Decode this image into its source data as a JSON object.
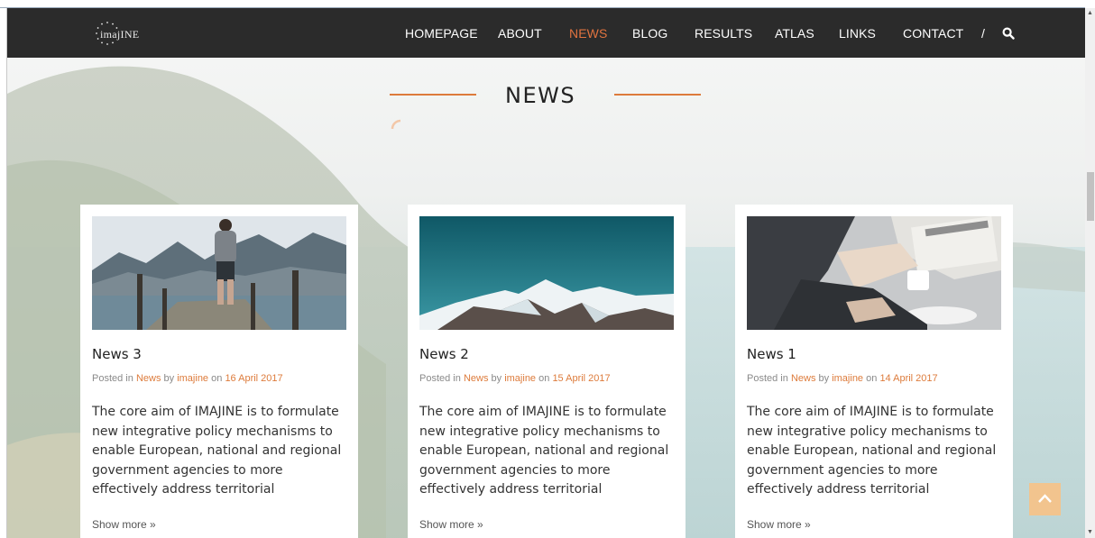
{
  "brand": {
    "logo_text": "imajINE"
  },
  "nav": {
    "items": [
      {
        "label": "HOMEPAGE",
        "active": false
      },
      {
        "label": "ABOUT",
        "active": false
      },
      {
        "label": "NEWS",
        "active": true
      },
      {
        "label": "BLOG",
        "active": false
      },
      {
        "label": "RESULTS",
        "active": false
      },
      {
        "label": "ATLAS",
        "active": false
      },
      {
        "label": "LINKS",
        "active": false
      },
      {
        "label": "CONTACT",
        "active": false
      }
    ],
    "separator": "/",
    "search_icon": "search-icon"
  },
  "page": {
    "heading": "NEWS"
  },
  "posts": [
    {
      "title": "News 3",
      "meta": {
        "posted_in": "Posted in",
        "category": "News",
        "by": "by",
        "author": "imajine",
        "on": "on",
        "date": "16 April 2017"
      },
      "excerpt": "The core aim of IMAJINE is to formulate new integrative policy mechanisms to enable European, national and regional government agencies to more effectively address territorial",
      "more": "Show more »",
      "image": "man-on-pier-mountains"
    },
    {
      "title": "News 2",
      "meta": {
        "posted_in": "Posted in",
        "category": "News",
        "by": "by",
        "author": "imajine",
        "on": "on",
        "date": "15 April 2017"
      },
      "excerpt": "The core aim of IMAJINE is to formulate new integrative policy mechanisms to enable European, national and regional government agencies to more effectively address territorial",
      "more": "Show more »",
      "image": "snowy-mountain-teal-sky"
    },
    {
      "title": "News 1",
      "meta": {
        "posted_in": "Posted in",
        "category": "News",
        "by": "by",
        "author": "imajine",
        "on": "on",
        "date": "14 April 2017"
      },
      "excerpt": "The core aim of IMAJINE is to formulate new integrative policy mechanisms to enable European, national and regional government agencies to more effectively address territorial",
      "more": "Show more »",
      "image": "newspaper-coffee-business"
    }
  ],
  "colors": {
    "accent": "#dd7b3b",
    "nav_bg": "#2b2b2b",
    "to_top": "#f2c48e"
  }
}
